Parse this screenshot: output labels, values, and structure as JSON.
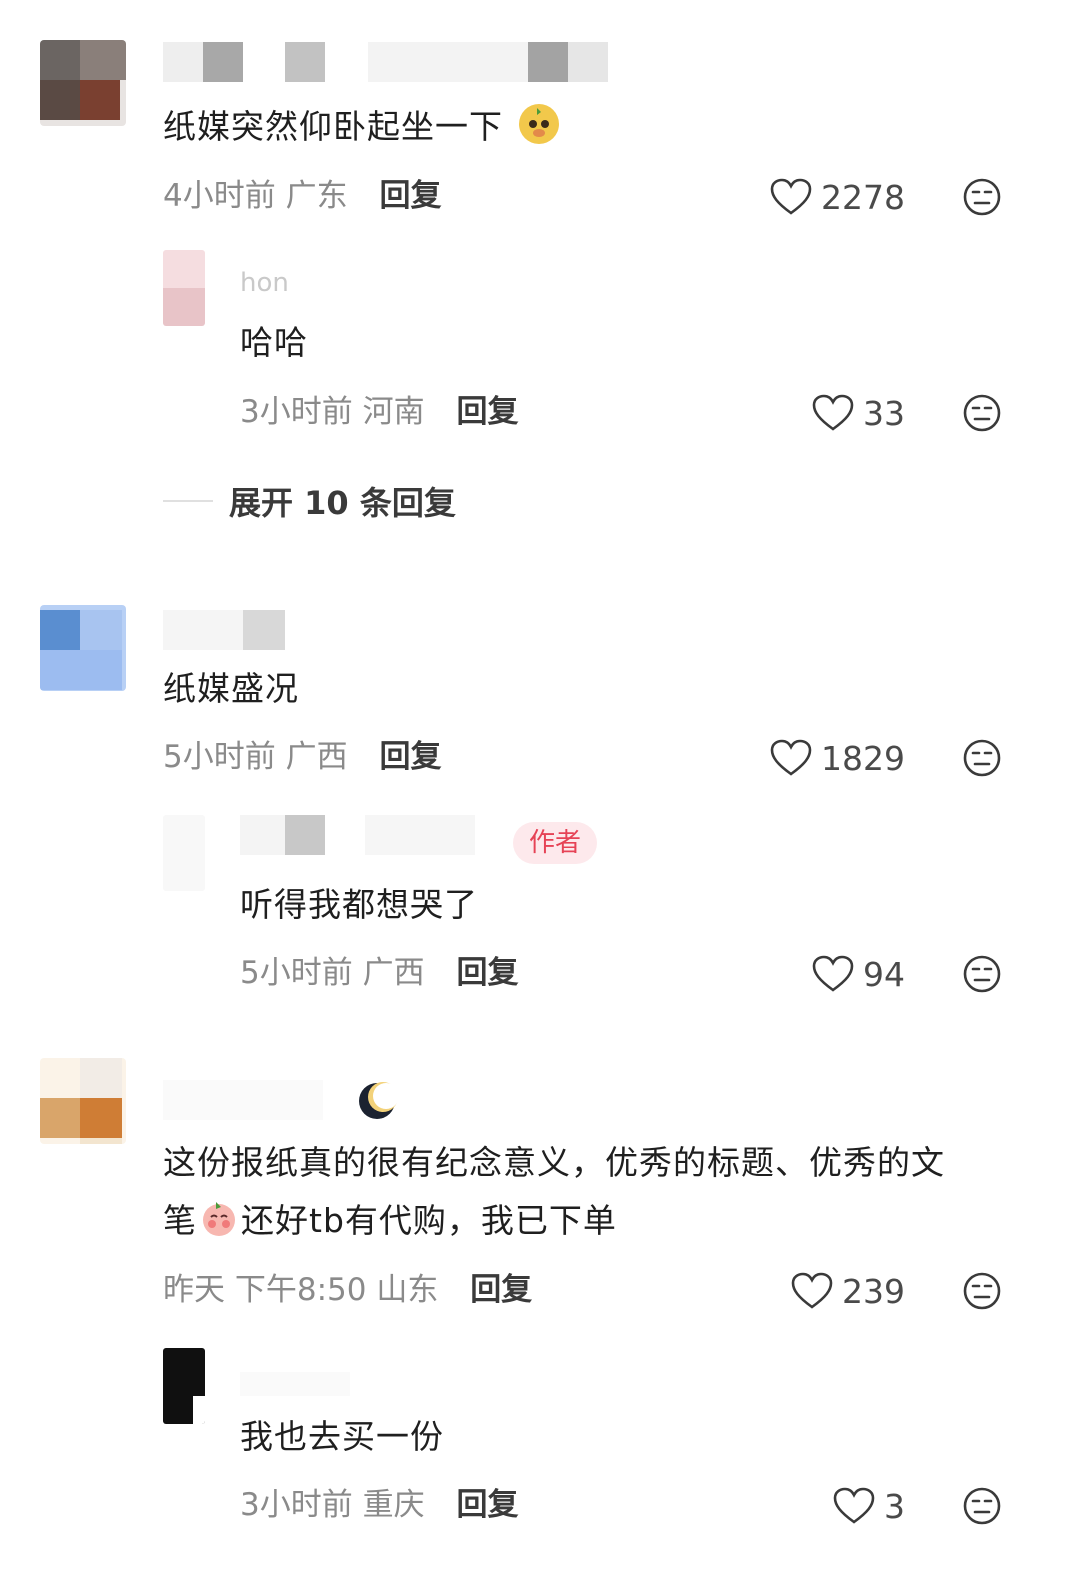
{
  "comments": [
    {
      "text": "纸媒突然仰卧起坐一下",
      "time": "4小时前",
      "location": "广东",
      "reply_label": "回复",
      "likes": "2278",
      "replies": [
        {
          "name_visible": "hon",
          "text": "哈哈",
          "time": "3小时前",
          "location": "河南",
          "reply_label": "回复",
          "likes": "33"
        }
      ],
      "expand_label": "展开 10 条回复"
    },
    {
      "text": "纸媒盛况",
      "time": "5小时前",
      "location": "广西",
      "reply_label": "回复",
      "likes": "1829",
      "replies": [
        {
          "author_badge": "作者",
          "text": "听得我都想哭了",
          "time": "5小时前",
          "location": "广西",
          "reply_label": "回复",
          "likes": "94"
        }
      ]
    },
    {
      "text_line1": "这份报纸真的很有纪念意义，优秀的标题、优秀的文",
      "text_line2_a": "笔",
      "text_line2_b": "还好tb有代购，我已下单",
      "time": "昨天 下午8:50",
      "location": "山东",
      "reply_label": "回复",
      "likes": "239",
      "replies": [
        {
          "text": "我也去买一份",
          "time": "3小时前",
          "location": "重庆",
          "reply_label": "回复",
          "likes": "3"
        }
      ]
    }
  ],
  "icons": {
    "like": "heart-outline-icon",
    "dislike": "neutral-face-icon",
    "emoji1": "cute-dog-emoji",
    "emoji2": "blushing-face-emoji",
    "moon": "crescent-moon-icon"
  },
  "colors": {
    "primary_text": "#1f1f1f",
    "meta_text": "#8a8a8a",
    "badge_bg": "#fde9ec",
    "badge_text": "#e64356"
  }
}
